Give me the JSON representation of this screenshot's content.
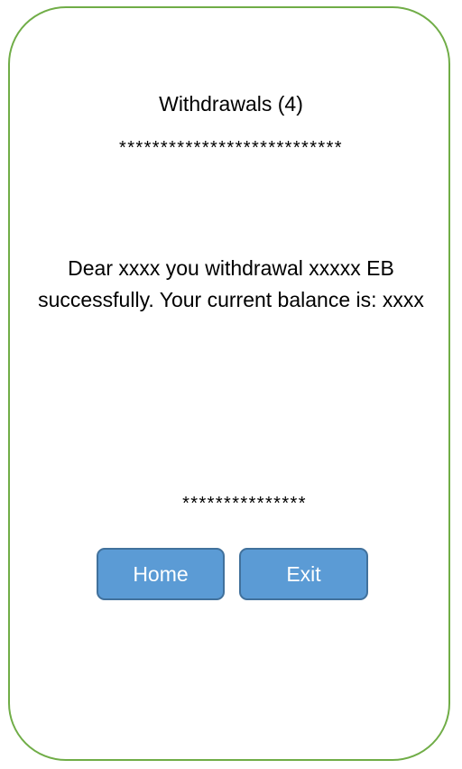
{
  "screen": {
    "title": "Withdrawals (4)",
    "separator_top": "***************************",
    "message": "Dear xxxx you withdrawal xxxxx EB successfully. Your current balance is: xxxx",
    "separator_bottom": "***************"
  },
  "buttons": {
    "home_label": "Home",
    "exit_label": "Exit"
  },
  "colors": {
    "frame_border": "#70ad47",
    "button_fill": "#5b9bd5",
    "button_border": "#41719c",
    "button_text": "#ffffff"
  }
}
